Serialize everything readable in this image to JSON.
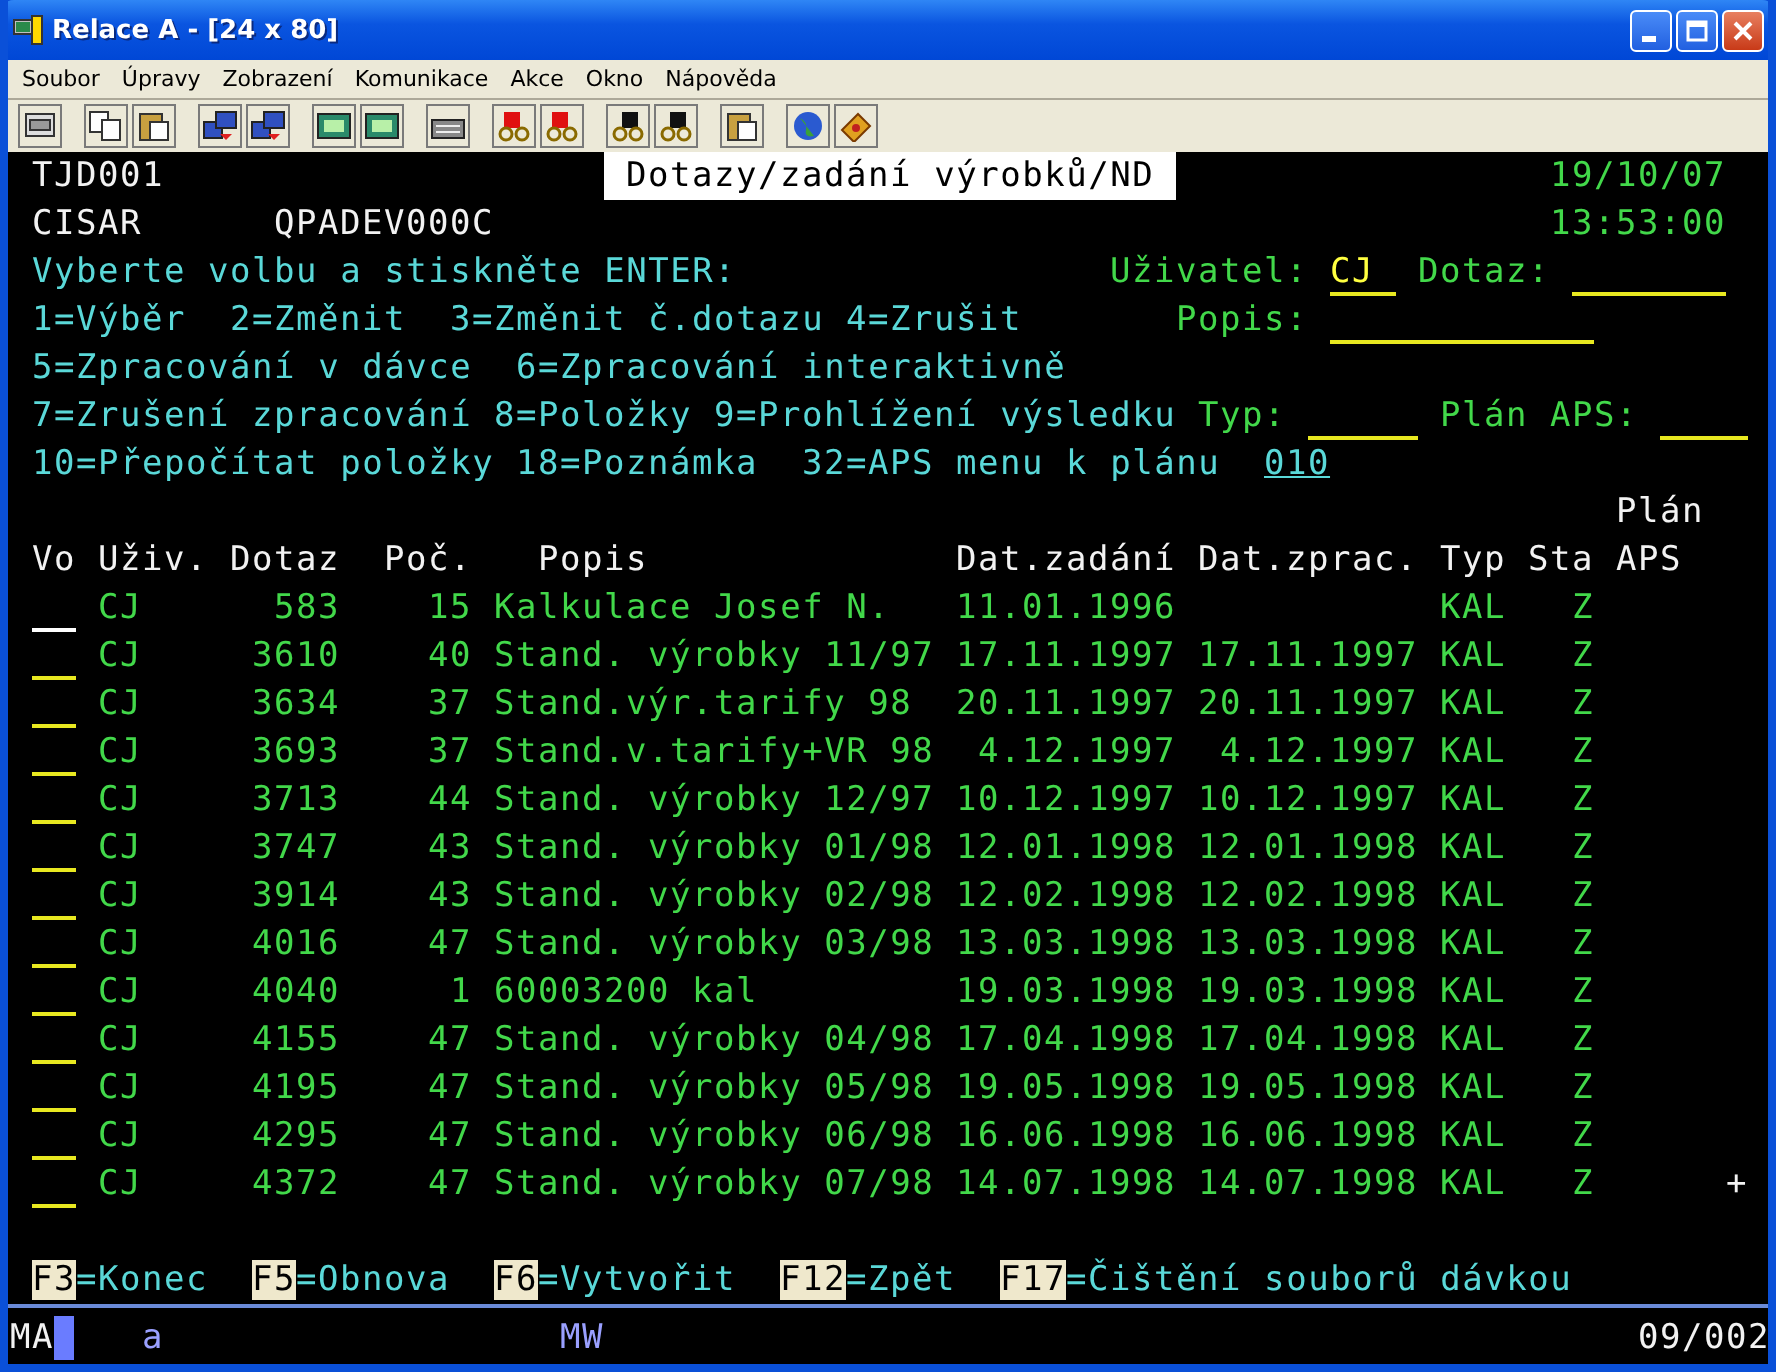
{
  "window": {
    "title": "Relace A - [24 x 80]"
  },
  "menu": [
    "Soubor",
    "Úpravy",
    "Zobrazení",
    "Komunikace",
    "Akce",
    "Okno",
    "Nápověda"
  ],
  "screen": {
    "program": "TJD001",
    "title": "Dotazy/zadání výrobků/ND",
    "date": "19/10/07",
    "user": "CISAR",
    "device": "QPADEV000C",
    "time": "13:53:00",
    "prompt": "Vyberte volbu a stiskněte ENTER:",
    "filters": [
      {
        "label": "Uživatel:",
        "value": "CJ"
      },
      {
        "label": "Dotaz:"
      },
      {
        "label": "Popis:"
      },
      {
        "label": "Typ:"
      },
      {
        "label": "Plán APS:"
      }
    ],
    "option_lines": [
      [
        "1=Výběr",
        "2=Změnit",
        "3=Změnit č.dotazu",
        "4=Zrušit"
      ],
      [
        "5=Zpracování v dávce",
        "6=Zpracování interaktivně"
      ],
      [
        "7=Zrušení zpracování",
        "8=Položky",
        "9=Prohlížení výsledku"
      ],
      [
        "10=Přepočítat položky",
        "18=Poznámka",
        "32=APS menu k plánu"
      ]
    ],
    "plan_value": "010",
    "columns": [
      {
        "label": "Vo"
      },
      {
        "label": "Uživ."
      },
      {
        "label": "Dotaz"
      },
      {
        "label": "Poč."
      },
      {
        "label": "Popis"
      },
      {
        "label": "Dat.zadání"
      },
      {
        "label": "Dat.zprac."
      },
      {
        "label": "Typ"
      },
      {
        "label": "Sta"
      },
      {
        "label": "APS",
        "above": "Plán"
      }
    ],
    "rows": [
      {
        "cursor": true,
        "user": "CJ",
        "query": "583",
        "count": "15",
        "description": "Kalkulace Josef N.",
        "entered": "11.01.1996",
        "type": "KAL",
        "status": "Z"
      },
      {
        "cursor": false,
        "user": "CJ",
        "query": "3610",
        "count": "40",
        "description": "Stand. výrobky 11/97",
        "entered": "17.11.1997",
        "processed": "17.11.1997",
        "type": "KAL",
        "status": "Z"
      },
      {
        "cursor": false,
        "user": "CJ",
        "query": "3634",
        "count": "37",
        "description": "Stand.výr.tarify 98",
        "entered": "20.11.1997",
        "processed": "20.11.1997",
        "type": "KAL",
        "status": "Z"
      },
      {
        "cursor": false,
        "user": "CJ",
        "query": "3693",
        "count": "37",
        "description": "Stand.v.tarify+VR 98",
        "entered": "4.12.1997",
        "processed": "4.12.1997",
        "type": "KAL",
        "status": "Z"
      },
      {
        "cursor": false,
        "user": "CJ",
        "query": "3713",
        "count": "44",
        "description": "Stand. výrobky 12/97",
        "entered": "10.12.1997",
        "processed": "10.12.1997",
        "type": "KAL",
        "status": "Z"
      },
      {
        "cursor": false,
        "user": "CJ",
        "query": "3747",
        "count": "43",
        "description": "Stand. výrobky 01/98",
        "entered": "12.01.1998",
        "processed": "12.01.1998",
        "type": "KAL",
        "status": "Z"
      },
      {
        "cursor": false,
        "user": "CJ",
        "query": "3914",
        "count": "43",
        "description": "Stand. výrobky 02/98",
        "entered": "12.02.1998",
        "processed": "12.02.1998",
        "type": "KAL",
        "status": "Z"
      },
      {
        "cursor": false,
        "user": "CJ",
        "query": "4016",
        "count": "47",
        "description": "Stand. výrobky 03/98",
        "entered": "13.03.1998",
        "processed": "13.03.1998",
        "type": "KAL",
        "status": "Z"
      },
      {
        "cursor": false,
        "user": "CJ",
        "query": "4040",
        "count": "1",
        "description": "60003200 kal",
        "entered": "19.03.1998",
        "processed": "19.03.1998",
        "type": "KAL",
        "status": "Z"
      },
      {
        "cursor": false,
        "user": "CJ",
        "query": "4155",
        "count": "47",
        "description": "Stand. výrobky 04/98",
        "entered": "17.04.1998",
        "processed": "17.04.1998",
        "type": "KAL",
        "status": "Z"
      },
      {
        "cursor": false,
        "user": "CJ",
        "query": "4195",
        "count": "47",
        "description": "Stand. výrobky 05/98",
        "entered": "19.05.1998",
        "processed": "19.05.1998",
        "type": "KAL",
        "status": "Z"
      },
      {
        "cursor": false,
        "user": "CJ",
        "query": "4295",
        "count": "47",
        "description": "Stand. výrobky 06/98",
        "entered": "16.06.1998",
        "processed": "16.06.1998",
        "type": "KAL",
        "status": "Z"
      },
      {
        "cursor": false,
        "user": "CJ",
        "query": "4372",
        "count": "47",
        "description": "Stand. výrobky 07/98",
        "entered": "14.07.1998",
        "processed": "14.07.1998",
        "type": "KAL",
        "status": "Z"
      }
    ],
    "more": "+",
    "function_keys": [
      {
        "key": "F3",
        "label": "=Konec"
      },
      {
        "key": "F5",
        "label": "=Obnova"
      },
      {
        "key": "F6",
        "label": "=Vytvořit"
      },
      {
        "key": "F12",
        "label": "=Zpět"
      },
      {
        "key": "F17",
        "label": "=Čištění souborů dávkou"
      }
    ]
  },
  "status_bar": {
    "mode": "MA",
    "input": "a",
    "session": "MW",
    "cursor_position": "09/002"
  }
}
